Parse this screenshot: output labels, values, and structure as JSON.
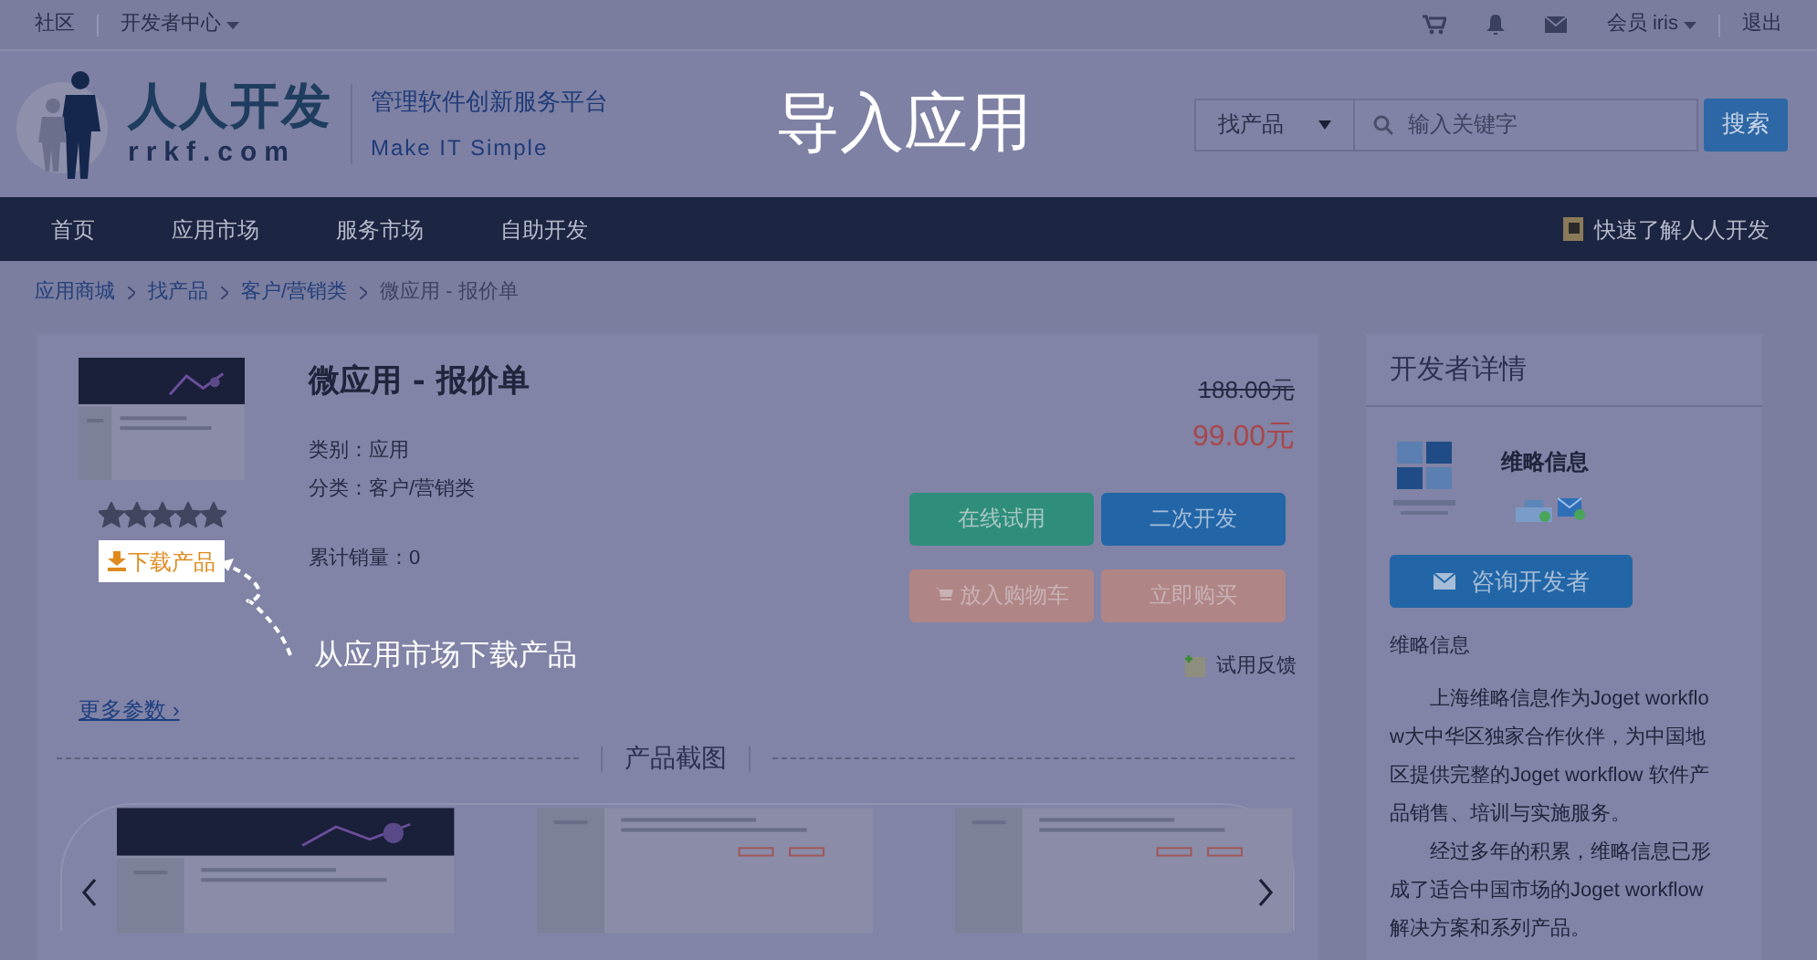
{
  "top_bar": {
    "links": [
      "社区",
      "开发者中心"
    ],
    "user": "会员 iris",
    "logout": "退出"
  },
  "header": {
    "logo_text": "人人开发",
    "logo_domain": "rrkf.com",
    "slogan": "管理软件创新服务平台",
    "slogan_en": "Make IT Simple",
    "search": {
      "category": "找产品",
      "placeholder": "输入关键字",
      "button": "搜索"
    }
  },
  "overlay_title": "导入应用",
  "nav": {
    "items": [
      "首页",
      "应用市场",
      "服务市场",
      "自助开发"
    ],
    "right_link": "快速了解人人开发"
  },
  "breadcrumb": [
    "应用商城",
    "找产品",
    "客户/营销类",
    "微应用 - 报价单"
  ],
  "product": {
    "title": "微应用 - 报价单",
    "fields": [
      "类别：应用",
      "分类：客户/营销类"
    ],
    "sales": "累计销量：0",
    "stars": 5,
    "download": "下载产品",
    "original_price": "188.00元",
    "price": "99.00元",
    "buttons": [
      {
        "label": "在线试用",
        "kind": "trial"
      },
      {
        "label": "二次开发",
        "kind": "develop"
      },
      {
        "label": "放入购物车",
        "kind": "cart"
      },
      {
        "label": "立即购买",
        "kind": "buy"
      }
    ],
    "feedback": "试用反馈",
    "more": "更多参数 ›",
    "screenshots_title": "产品截图",
    "screenshots": [
      {
        "kind": "picture"
      },
      {
        "kind": "picture"
      },
      {
        "kind": "picture"
      }
    ]
  },
  "annotation": "从应用市场下载产品",
  "developer": {
    "heading": "开发者详情",
    "name": "维略信息",
    "contact": "咨询开发者",
    "section": "维略信息",
    "paragraphs": [
      "上海维略信息作为Joget workflow大中华区独家合作伙伴，为中国地区提供完整的Joget workflow 软件产品销售、培训与实施服务。",
      "经过多年的积累，维略信息已形成了适合中国市场的Joget workflow解决方案和系列产品。"
    ]
  }
}
